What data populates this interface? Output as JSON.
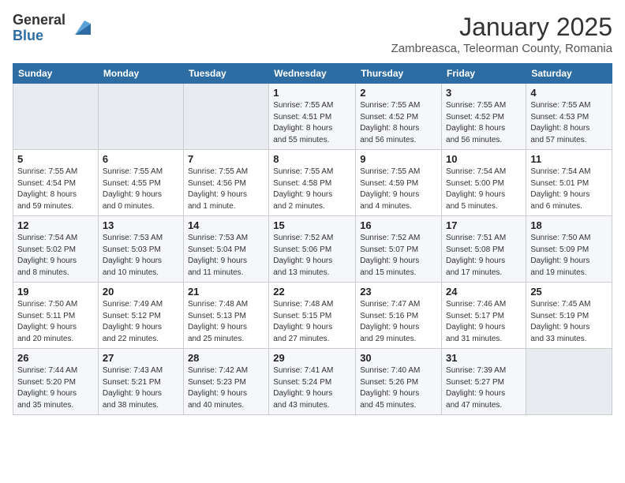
{
  "header": {
    "logo_general": "General",
    "logo_blue": "Blue",
    "month": "January 2025",
    "location": "Zambreasca, Teleorman County, Romania"
  },
  "weekdays": [
    "Sunday",
    "Monday",
    "Tuesday",
    "Wednesday",
    "Thursday",
    "Friday",
    "Saturday"
  ],
  "weeks": [
    [
      {
        "day": "",
        "info": ""
      },
      {
        "day": "",
        "info": ""
      },
      {
        "day": "",
        "info": ""
      },
      {
        "day": "1",
        "info": "Sunrise: 7:55 AM\nSunset: 4:51 PM\nDaylight: 8 hours\nand 55 minutes."
      },
      {
        "day": "2",
        "info": "Sunrise: 7:55 AM\nSunset: 4:52 PM\nDaylight: 8 hours\nand 56 minutes."
      },
      {
        "day": "3",
        "info": "Sunrise: 7:55 AM\nSunset: 4:52 PM\nDaylight: 8 hours\nand 56 minutes."
      },
      {
        "day": "4",
        "info": "Sunrise: 7:55 AM\nSunset: 4:53 PM\nDaylight: 8 hours\nand 57 minutes."
      }
    ],
    [
      {
        "day": "5",
        "info": "Sunrise: 7:55 AM\nSunset: 4:54 PM\nDaylight: 8 hours\nand 59 minutes."
      },
      {
        "day": "6",
        "info": "Sunrise: 7:55 AM\nSunset: 4:55 PM\nDaylight: 9 hours\nand 0 minutes."
      },
      {
        "day": "7",
        "info": "Sunrise: 7:55 AM\nSunset: 4:56 PM\nDaylight: 9 hours\nand 1 minute."
      },
      {
        "day": "8",
        "info": "Sunrise: 7:55 AM\nSunset: 4:58 PM\nDaylight: 9 hours\nand 2 minutes."
      },
      {
        "day": "9",
        "info": "Sunrise: 7:55 AM\nSunset: 4:59 PM\nDaylight: 9 hours\nand 4 minutes."
      },
      {
        "day": "10",
        "info": "Sunrise: 7:54 AM\nSunset: 5:00 PM\nDaylight: 9 hours\nand 5 minutes."
      },
      {
        "day": "11",
        "info": "Sunrise: 7:54 AM\nSunset: 5:01 PM\nDaylight: 9 hours\nand 6 minutes."
      }
    ],
    [
      {
        "day": "12",
        "info": "Sunrise: 7:54 AM\nSunset: 5:02 PM\nDaylight: 9 hours\nand 8 minutes."
      },
      {
        "day": "13",
        "info": "Sunrise: 7:53 AM\nSunset: 5:03 PM\nDaylight: 9 hours\nand 10 minutes."
      },
      {
        "day": "14",
        "info": "Sunrise: 7:53 AM\nSunset: 5:04 PM\nDaylight: 9 hours\nand 11 minutes."
      },
      {
        "day": "15",
        "info": "Sunrise: 7:52 AM\nSunset: 5:06 PM\nDaylight: 9 hours\nand 13 minutes."
      },
      {
        "day": "16",
        "info": "Sunrise: 7:52 AM\nSunset: 5:07 PM\nDaylight: 9 hours\nand 15 minutes."
      },
      {
        "day": "17",
        "info": "Sunrise: 7:51 AM\nSunset: 5:08 PM\nDaylight: 9 hours\nand 17 minutes."
      },
      {
        "day": "18",
        "info": "Sunrise: 7:50 AM\nSunset: 5:09 PM\nDaylight: 9 hours\nand 19 minutes."
      }
    ],
    [
      {
        "day": "19",
        "info": "Sunrise: 7:50 AM\nSunset: 5:11 PM\nDaylight: 9 hours\nand 20 minutes."
      },
      {
        "day": "20",
        "info": "Sunrise: 7:49 AM\nSunset: 5:12 PM\nDaylight: 9 hours\nand 22 minutes."
      },
      {
        "day": "21",
        "info": "Sunrise: 7:48 AM\nSunset: 5:13 PM\nDaylight: 9 hours\nand 25 minutes."
      },
      {
        "day": "22",
        "info": "Sunrise: 7:48 AM\nSunset: 5:15 PM\nDaylight: 9 hours\nand 27 minutes."
      },
      {
        "day": "23",
        "info": "Sunrise: 7:47 AM\nSunset: 5:16 PM\nDaylight: 9 hours\nand 29 minutes."
      },
      {
        "day": "24",
        "info": "Sunrise: 7:46 AM\nSunset: 5:17 PM\nDaylight: 9 hours\nand 31 minutes."
      },
      {
        "day": "25",
        "info": "Sunrise: 7:45 AM\nSunset: 5:19 PM\nDaylight: 9 hours\nand 33 minutes."
      }
    ],
    [
      {
        "day": "26",
        "info": "Sunrise: 7:44 AM\nSunset: 5:20 PM\nDaylight: 9 hours\nand 35 minutes."
      },
      {
        "day": "27",
        "info": "Sunrise: 7:43 AM\nSunset: 5:21 PM\nDaylight: 9 hours\nand 38 minutes."
      },
      {
        "day": "28",
        "info": "Sunrise: 7:42 AM\nSunset: 5:23 PM\nDaylight: 9 hours\nand 40 minutes."
      },
      {
        "day": "29",
        "info": "Sunrise: 7:41 AM\nSunset: 5:24 PM\nDaylight: 9 hours\nand 43 minutes."
      },
      {
        "day": "30",
        "info": "Sunrise: 7:40 AM\nSunset: 5:26 PM\nDaylight: 9 hours\nand 45 minutes."
      },
      {
        "day": "31",
        "info": "Sunrise: 7:39 AM\nSunset: 5:27 PM\nDaylight: 9 hours\nand 47 minutes."
      },
      {
        "day": "",
        "info": ""
      }
    ]
  ]
}
